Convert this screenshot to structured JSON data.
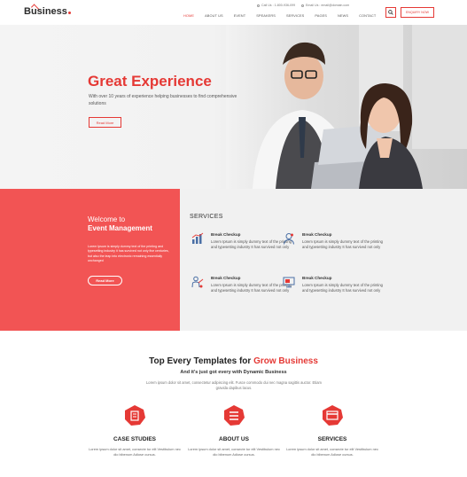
{
  "header": {
    "logo": "Business",
    "phone": "Call Us : 1-800-936-099",
    "email": "Email Us : email@domain.com",
    "nav": [
      "Home",
      "About Us",
      "Event",
      "Speakers",
      "Services",
      "Pages",
      "News",
      "Contact"
    ],
    "active_nav": "Home",
    "enquiry_label": "Enquiry Now",
    "accent_color": "#e53935"
  },
  "hero": {
    "title": "Great Experience",
    "subtitle": "With over 10 years of experience helping businesses to find comprehensive solutions",
    "button": "Read More"
  },
  "welcome": {
    "title_line1": "Welcome to",
    "title_line2": "Event Management",
    "text": "Lorem Ipsum is simply dummy text of the printing and typesetting industry it has survived not only five centuries, but also the leap into electronic remaining essentially unchanged",
    "button": "Read More",
    "background": "#f25454"
  },
  "services": {
    "title": "SERVICES",
    "items": [
      {
        "title": "Break Checkup",
        "text": "Lorem Ipsum is simply dummy text of the printing and typesetting industry It has survived not only",
        "icon": "chart-icon"
      },
      {
        "title": "Break Checkup",
        "text": "Lorem Ipsum is simply dummy text of the printing and typesetting industry It has survived not only",
        "icon": "person-icon"
      },
      {
        "title": "Break Checkup",
        "text": "Lorem Ipsum is simply dummy text of the printing and typesetting industry It has survived not only",
        "icon": "presenter-icon"
      },
      {
        "title": "Break Checkup",
        "text": "Lorem Ipsum is simply dummy text of the printing and typesetting industry It has survived not only",
        "icon": "monitor-icon"
      }
    ]
  },
  "features_section": {
    "title_prefix": "Top Every Templates for",
    "title_highlight": "Grow Business",
    "subtitle": "And it's just got every with Dynamic Business",
    "description": "Lorem ipsum dolor sit amet, consectetur adipiscing elit. Fusce commodo dui nec magna sagittis auctor. Etiam gravida dapibus lacus.",
    "features": [
      {
        "title": "CASE STUDIES",
        "text": "Lorem ipsum dolor sit amet, consecte tur elit Vestibulum nec dio bibenum Adiose cursus.",
        "icon": "book-icon"
      },
      {
        "title": "ABOUT US",
        "text": "Lorem ipsum dolor sit amet, consecte tur elit Vestibulum nec dio bibenum Adiose cursus.",
        "icon": "menu-icon"
      },
      {
        "title": "SERVICES",
        "text": "Lorem ipsum dolor sit amet, consecte tur elit Vestibulum nec dio bibenum Adiose cursus.",
        "icon": "card-icon"
      }
    ]
  }
}
